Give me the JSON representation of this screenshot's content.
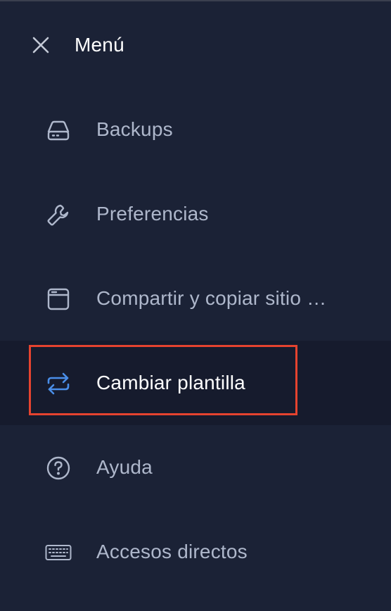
{
  "header": {
    "title": "Menú",
    "close_icon": "close-icon"
  },
  "menu": {
    "items": [
      {
        "key": "backups",
        "label": "Backups",
        "icon": "hard-drive-icon",
        "active": false
      },
      {
        "key": "preferences",
        "label": "Preferencias",
        "icon": "wrench-icon",
        "active": false
      },
      {
        "key": "share-copy",
        "label": "Compartir y copiar sitio …",
        "icon": "browser-window-icon",
        "active": false
      },
      {
        "key": "change-template",
        "label": "Cambiar plantilla",
        "icon": "swap-arrows-icon",
        "active": true
      },
      {
        "key": "help",
        "label": "Ayuda",
        "icon": "help-circle-icon",
        "active": false
      },
      {
        "key": "shortcuts",
        "label": "Accesos directos",
        "icon": "keyboard-icon",
        "active": false
      }
    ]
  },
  "colors": {
    "background": "#1b2236",
    "active_background": "#161b2d",
    "text": "#aeb7cb",
    "active_text": "#ffffff",
    "accent_icon": "#4a8ee8",
    "highlight_border": "#e5432f"
  }
}
